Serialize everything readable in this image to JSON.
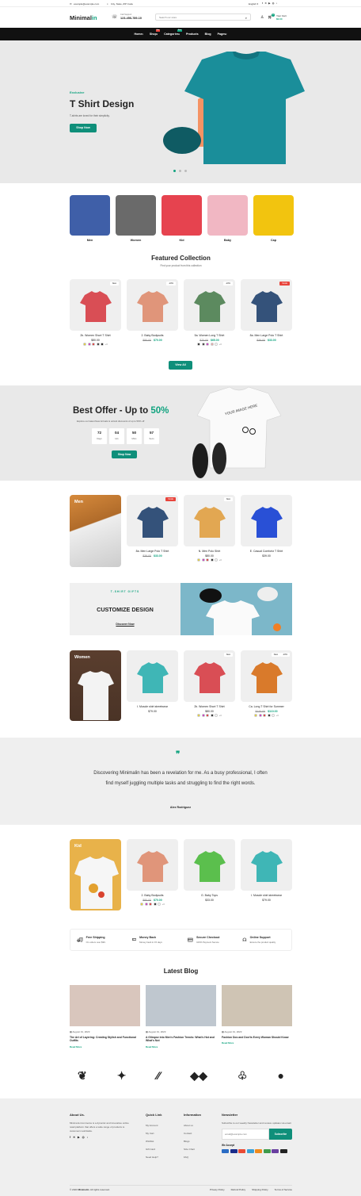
{
  "topbar": {
    "email": "example@example.com",
    "address": "City, State, ZIP Code",
    "language": "English"
  },
  "header": {
    "logo_main": "Minimal",
    "logo_accent": "in",
    "support_label": "Call Support",
    "phone": "123-456-789-10",
    "search_placeholder": "Search our store",
    "cart_label": "Your Cart",
    "cart_total": "$0.00",
    "cart_count": "0"
  },
  "nav": {
    "items": [
      {
        "label": "Home",
        "arrow": "▾"
      },
      {
        "label": "Shop",
        "arrow": "▾",
        "badge": "Hot"
      },
      {
        "label": "Categories",
        "arrow": "▾",
        "badge": "New"
      },
      {
        "label": "Products",
        "arrow": ""
      },
      {
        "label": "Blog",
        "arrow": ""
      },
      {
        "label": "Pages",
        "arrow": "▾"
      }
    ]
  },
  "hero": {
    "eyebrow": "Exclusive",
    "title": "T Shirt Design",
    "subtitle": "T-shirts are loved for their simplicity.",
    "button": "Shop Now",
    "slide_active": 1,
    "slide_count": 3
  },
  "categories": [
    {
      "label": "Men",
      "color": "#3f5fa8"
    },
    {
      "label": "Women",
      "color": "#6a6a6a"
    },
    {
      "label": "Kid",
      "color": "#e6434f"
    },
    {
      "label": "Baby",
      "color": "#f1b7c3"
    },
    {
      "label": "Cap",
      "color": "#f2c40f"
    }
  ],
  "featured": {
    "title": "Featured Collection",
    "subtitle": "Find your product from this collection",
    "view_all": "View All",
    "products": [
      {
        "name": "2b. Women Short T Shirt",
        "old": "",
        "price": "$80.00",
        "badge": "New",
        "badge_red": false,
        "color": "#d94e55",
        "swatches": [
          "#e9cf18",
          "#c81ac1",
          "#e41f1f",
          "#222222",
          "#000000"
        ],
        "more": "+3"
      },
      {
        "name": "2. Baby Bodysuits",
        "old": "$80.00",
        "price": "$70.00",
        "badge": "-10%",
        "badge_red": false,
        "color": "#e0957a",
        "swatches": [],
        "more": ""
      },
      {
        "name": "5a. Women Long T Shirt",
        "old": "$70.00",
        "price": "$65.00",
        "badge": "-10%",
        "badge_red": false,
        "color": "#5c8a5f",
        "swatches": [
          "#111111",
          "#222222",
          "#c81ac1",
          "#e7a1a1",
          "#ffffff"
        ],
        "more": "+3"
      },
      {
        "name": "8a. Men Large Polo T Shirt",
        "old": "$39.00",
        "price": "$33.00",
        "badge": "SALE",
        "badge_red": true,
        "color": "#34527a",
        "swatches": [],
        "more": ""
      }
    ]
  },
  "offer": {
    "title_prefix": "Best Offer - Up to ",
    "title_accent": "50%",
    "subtitle": "Explore our latest New Arrivals & unlock discounts of up to 50% off",
    "button": "Shop Now",
    "countdown": [
      {
        "value": "72",
        "label": "Days"
      },
      {
        "value": "04",
        "label": "Hrs"
      },
      {
        "value": "50",
        "label": "Mins"
      },
      {
        "value": "57",
        "label": "Secs"
      }
    ],
    "tee_text": "YOUR IMAGE HERE"
  },
  "men": {
    "label": "Men",
    "products": [
      {
        "name": "8a. Men Large Polo T Shirt",
        "old": "$39.00",
        "price": "$33.00",
        "badge": "SALE",
        "badge_red": true,
        "color": "#34527a",
        "swatches": [],
        "more": ""
      },
      {
        "name": "N. Men Polo Shirt",
        "old": "",
        "price": "$80.00",
        "badge": "New",
        "badge_red": false,
        "color": "#e2a752",
        "swatches": [
          "#e9cf18",
          "#c81ac1",
          "#e41f1f",
          "#111111",
          "#ffffff"
        ],
        "more": "+3"
      },
      {
        "name": "E. Casual Comfortz T Shirt",
        "old": "",
        "price": "$39.00",
        "badge": "",
        "badge_red": false,
        "color": "#2950d6",
        "swatches": [],
        "more": ""
      }
    ]
  },
  "gifts": {
    "eyebrow": "T-SHIRT GIFTS",
    "title": "CUSTOMIZE DESIGN",
    "link": "Discover Now"
  },
  "women": {
    "label": "Women",
    "products": [
      {
        "name": "I. Muscle shirt streetwear",
        "old": "",
        "price": "$79.00",
        "badge": "",
        "badge_red": false,
        "color": "#3fb6b6",
        "swatches": [],
        "more": ""
      },
      {
        "name": "2b. Women Short T Shirt",
        "old": "",
        "price": "$80.00",
        "badge": "New",
        "badge_red": false,
        "color": "#d94e55",
        "swatches": [
          "#e9cf18",
          "#c81ac1",
          "#e41f1f",
          "#111111",
          "#ffffff"
        ],
        "more": "+3"
      },
      {
        "name": "Ca. Long T Shirt for Summer",
        "old": "$120.00",
        "price": "$110.00",
        "badge": "-10%",
        "badge2": "New",
        "badge_red": false,
        "color": "#d97a2b",
        "swatches": [
          "#e9cf18",
          "#c81ac1",
          "#e41f1f",
          "#111111",
          "#ffffff"
        ],
        "more": "+3"
      }
    ]
  },
  "testimonial": {
    "quote": "Discovering Minimalin has been a revelation for me. As a busy professional, I often find myself juggling multiple tasks and struggling to find the right words.",
    "author": "Alex Rodriguez"
  },
  "kid": {
    "label": "Kid",
    "products": [
      {
        "name": "2. Baby Bodysuits",
        "old": "$80.00",
        "price": "$70.00",
        "badge": "",
        "badge_red": false,
        "color": "#e0957a",
        "swatches": [
          "#e9cf18",
          "#c81ac1",
          "#e41f1f",
          "#111111",
          "#ffffff"
        ],
        "more": "+3"
      },
      {
        "name": "G. Baby Tops",
        "old": "",
        "price": "$33.00",
        "badge": "",
        "badge_red": false,
        "color": "#5bbf4d",
        "swatches": [],
        "more": ""
      },
      {
        "name": "I. Muscle shirt streetwear",
        "old": "",
        "price": "$79.00",
        "badge": "",
        "badge_red": false,
        "color": "#3fb6b6",
        "swatches": [],
        "more": ""
      }
    ]
  },
  "features": [
    {
      "title": "Free Shipping",
      "desc": "On orders over $99.",
      "icon": "truck-icon"
    },
    {
      "title": "Money Back",
      "desc": "Money back in 15 days",
      "icon": "money-icon"
    },
    {
      "title": "Secure Checkout",
      "desc": "100% Payment Secure",
      "icon": "card-icon"
    },
    {
      "title": "Online Support",
      "desc": "Ensure the product quality",
      "icon": "headset-icon"
    }
  ],
  "blog": {
    "title": "Latest Blog",
    "read_more": "Read More",
    "posts": [
      {
        "date": "August 31, 2023",
        "title": "The Art of Layering: Creating Stylish and Functional Outfits",
        "color": "#d9c6bd"
      },
      {
        "date": "August 31, 2023",
        "title": "A Glimpse into Men's Fashion Trends: What's Hot and What's Not",
        "color": "#bfc7cf"
      },
      {
        "date": "August 31, 2023",
        "title": "Fashion Dos and Don'ts Every Woman Should Know",
        "color": "#cfc4b4"
      }
    ]
  },
  "footer": {
    "about_title": "About Us.",
    "about_text": "Minima E-Commerce is a dynamic and innovative online retail platform that offers a wide range of products to customers worldwide.",
    "quick_title": "Quick Link",
    "quick": [
      "My Account",
      "My Cart",
      "Wishlist",
      "Gift Card",
      "Need Help?"
    ],
    "info_title": "Information",
    "info": [
      "About us",
      "Contact",
      "Blogs",
      "Size Chart",
      "FAQ"
    ],
    "news_title": "Newsletter",
    "news_text": "Subscribe to our weekly Newsletter and receive updates via email.",
    "email_placeholder": "email@example.com",
    "subscribe": "Subscribe",
    "accept": "We Accept",
    "copyright_prefix": "© 2023 ",
    "copyright_brand": "Minimalin",
    "copyright_suffix": ". All rights reserved.",
    "links": [
      "Privacy Policy",
      "Refund Policy",
      "Shipping Policy",
      "Terms of Service"
    ]
  }
}
